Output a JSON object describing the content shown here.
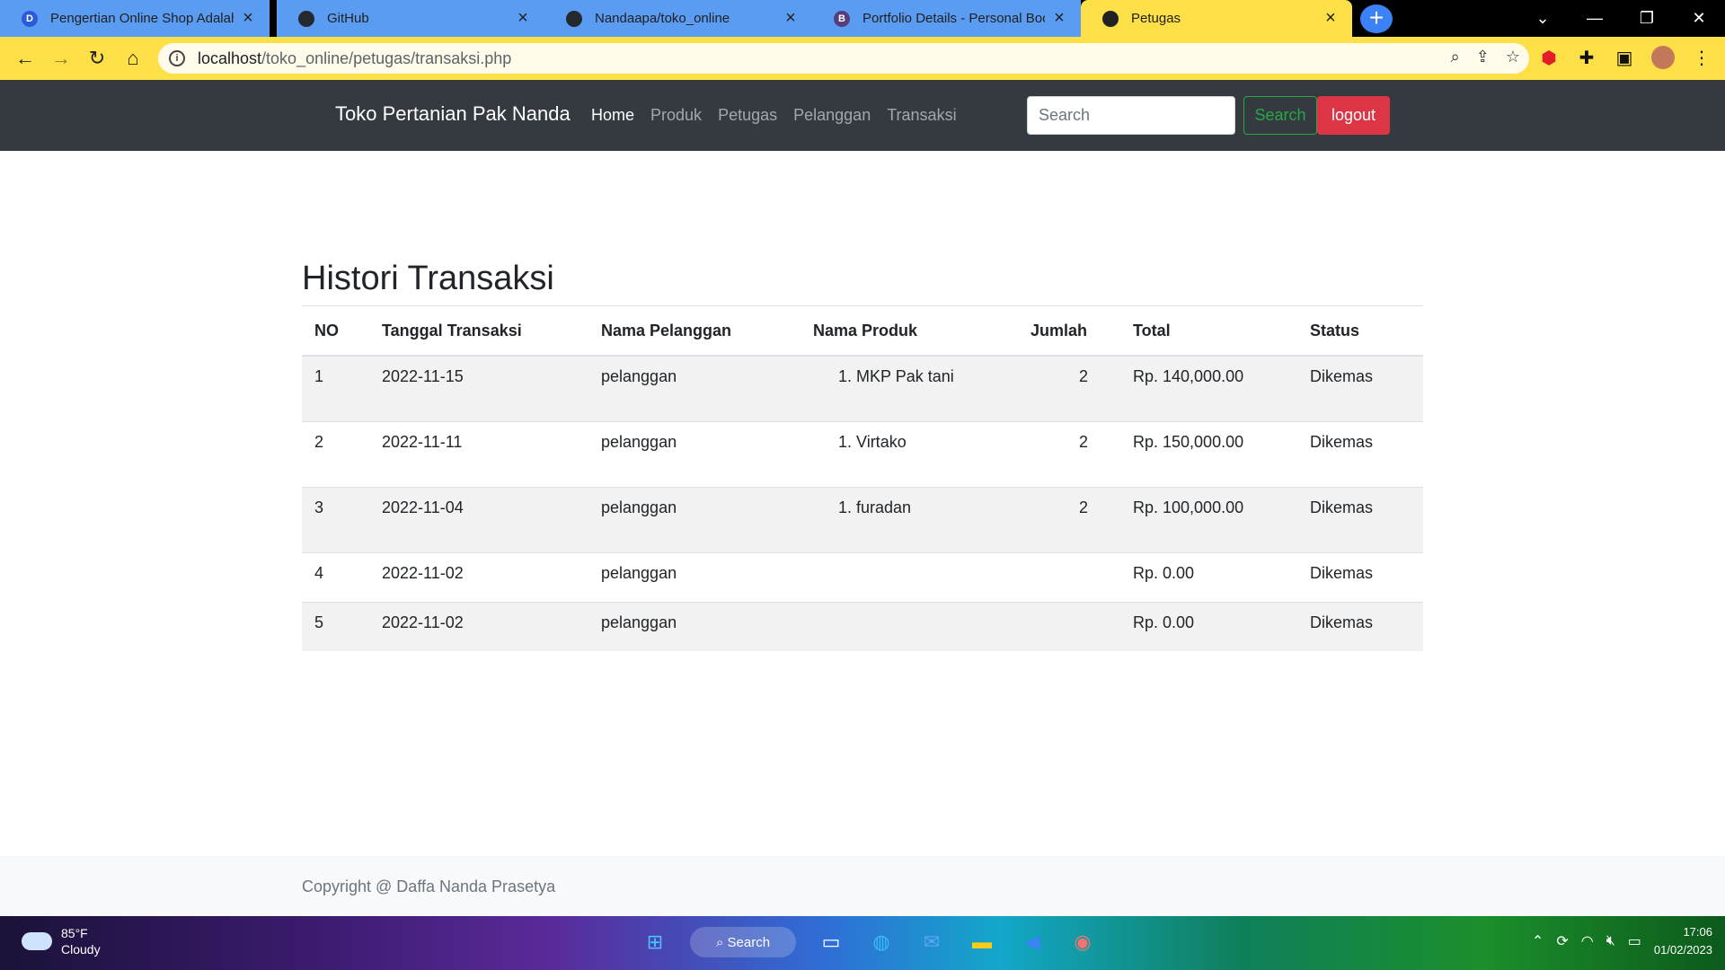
{
  "browser": {
    "tabs": [
      {
        "title": "Pengertian Online Shop Adalah :",
        "icon": "dicoding-icon",
        "favicon_letter": "D",
        "favicon_color": "#2b5bd7",
        "active": false
      },
      {
        "title": "GitHub",
        "icon": "github-icon",
        "favicon_letter": "",
        "favicon_color": "#24292f",
        "active": false
      },
      {
        "title": "Nandaapa/toko_online",
        "icon": "github-icon",
        "favicon_letter": "",
        "favicon_color": "#24292f",
        "active": false
      },
      {
        "title": "Portfolio Details - Personal Boots",
        "icon": "bootstrap-icon",
        "favicon_letter": "B",
        "favicon_color": "#563d7c",
        "active": false
      },
      {
        "title": "Petugas",
        "icon": "globe-icon",
        "favicon_letter": "",
        "favicon_color": "#222222",
        "active": true
      }
    ],
    "url_host": "localhost",
    "url_path": "/toko_online/petugas/transaksi.php",
    "accent": "#fde047"
  },
  "navbar": {
    "brand": "Toko Pertanian Pak Nanda",
    "links": [
      {
        "label": "Home",
        "active": true
      },
      {
        "label": "Produk",
        "active": false
      },
      {
        "label": "Petugas",
        "active": false
      },
      {
        "label": "Pelanggan",
        "active": false
      },
      {
        "label": "Transaksi",
        "active": false
      }
    ],
    "search_placeholder": "Search",
    "search_button": "Search",
    "logout_button": "logout",
    "bg_color": "#343a40"
  },
  "main": {
    "title": "Histori Transaksi",
    "columns": [
      "NO",
      "Tanggal Transaksi",
      "Nama Pelanggan",
      "Nama Produk",
      "Jumlah",
      "Total",
      "Status"
    ],
    "rows": [
      {
        "no": "1",
        "tanggal": "2022-11-15",
        "pelanggan": "pelanggan",
        "produk": "1. MKP Pak tani",
        "jumlah": "2",
        "total": "Rp. 140,000.00",
        "status": "Dikemas"
      },
      {
        "no": "2",
        "tanggal": "2022-11-11",
        "pelanggan": "pelanggan",
        "produk": "1. Virtako",
        "jumlah": "2",
        "total": "Rp. 150,000.00",
        "status": "Dikemas"
      },
      {
        "no": "3",
        "tanggal": "2022-11-04",
        "pelanggan": "pelanggan",
        "produk": "1. furadan",
        "jumlah": "2",
        "total": "Rp. 100,000.00",
        "status": "Dikemas"
      },
      {
        "no": "4",
        "tanggal": "2022-11-02",
        "pelanggan": "pelanggan",
        "produk": "",
        "jumlah": "",
        "total": "Rp. 0.00",
        "status": "Dikemas"
      },
      {
        "no": "5",
        "tanggal": "2022-11-02",
        "pelanggan": "pelanggan",
        "produk": "",
        "jumlah": "",
        "total": "Rp. 0.00",
        "status": "Dikemas"
      }
    ]
  },
  "footer": {
    "copyright": "Copyright @ Daffa Nanda Prasetya"
  },
  "taskbar": {
    "weather_temp": "85°F",
    "weather_desc": "Cloudy",
    "search_label": "Search",
    "time": "17:06",
    "date": "01/02/2023"
  }
}
